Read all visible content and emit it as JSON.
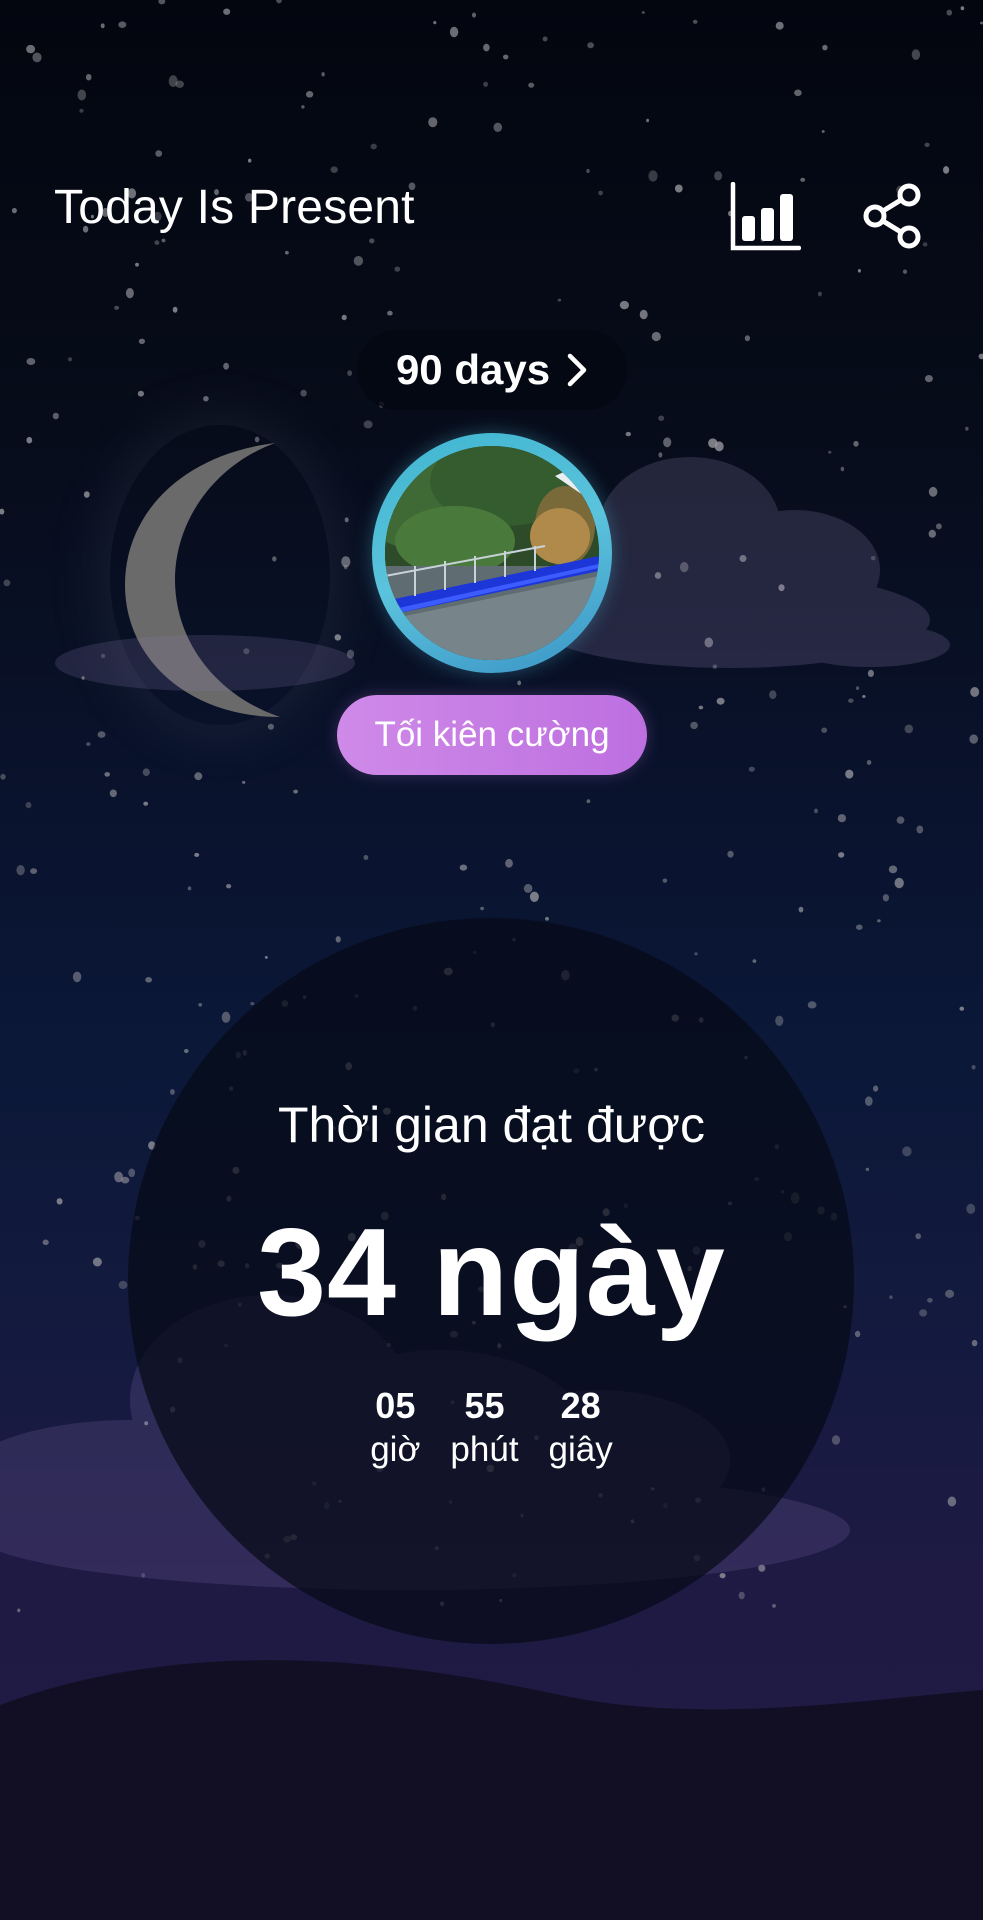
{
  "header": {
    "title": "Today Is Present",
    "stats_icon": "bar-chart-icon",
    "share_icon": "share-icon"
  },
  "goal": {
    "label": "90 days",
    "chevron_icon": "chevron-right-icon"
  },
  "level": {
    "label": "Tối kiên cường",
    "color": "#c77ee6"
  },
  "timer": {
    "label": "Thời gian đạt được",
    "days": "34 ngày",
    "units": [
      {
        "value": "05",
        "label": "giờ"
      },
      {
        "value": "55",
        "label": "phút"
      },
      {
        "value": "28",
        "label": "giây"
      }
    ]
  },
  "colors": {
    "avatar_ring": "#4fbcd8",
    "background_top": "#03060f",
    "background_bottom": "#221c46"
  }
}
